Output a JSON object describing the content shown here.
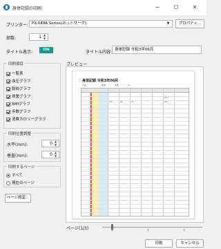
{
  "window": {
    "title": "身体記録の印刷",
    "minimize": "─",
    "maximize": "☐",
    "close": "✕"
  },
  "printer": {
    "label": "プリンター:",
    "value": "PX-049A Series(ネットワーク)",
    "properties_button": "プロパティ..."
  },
  "copies": {
    "label": "部数:",
    "value": "1"
  },
  "title_display": {
    "label": "タイトル表示:",
    "toggle": "ON"
  },
  "title_content": {
    "label": "タイトル内容:",
    "value": "身体記録 令和3年06月"
  },
  "print_items": {
    "title": "印刷項目",
    "items": [
      {
        "label": "一覧表",
        "checked": true
      },
      {
        "label": "血圧グラフ",
        "checked": true
      },
      {
        "label": "脈拍グラフ",
        "checked": true
      },
      {
        "label": "体重グラフ",
        "checked": true
      },
      {
        "label": "BMIグラフ",
        "checked": true
      },
      {
        "label": "歩数グラフ",
        "checked": true
      },
      {
        "label": "消費カロリーグラフ",
        "checked": true
      }
    ]
  },
  "print_position": {
    "title": "印刷位置調整",
    "horizontal": {
      "label": "水平(mm):",
      "value": "0"
    },
    "vertical": {
      "label": "垂直(mm):",
      "value": "0"
    }
  },
  "pages": {
    "title": "印刷するページ",
    "options": [
      {
        "label": "すべて",
        "selected": true
      },
      {
        "label": "現在のページ",
        "selected": false
      }
    ]
  },
  "page_setup_button": "ページ設定...",
  "preview": {
    "label": "プレビュー",
    "doc_title": "身体記録 令和3年06月",
    "doc_info": "氏名 : ・・・・・ 　年齢 : ・・ 　身長 : ・・・ cm",
    "sample_values": [
      "120",
      "80",
      "72",
      "65.0",
      "22.1"
    ]
  },
  "page_nav": {
    "label": "ページ(1/3)"
  },
  "buttons": {
    "print": "印刷",
    "cancel": "キャンセル"
  },
  "colors": {
    "toggle_on": "#0e9a92",
    "accent_icon": "#1f6fbf"
  }
}
